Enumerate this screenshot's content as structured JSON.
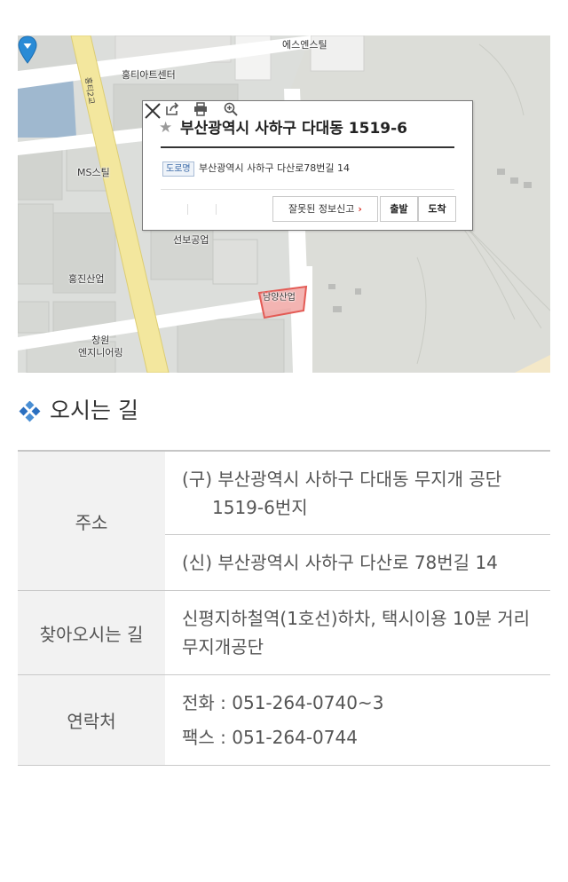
{
  "map": {
    "labels": {
      "es_enstil": "에스엔스틸",
      "hongti_art": "홍티아트센터",
      "bridge": "홍티2교",
      "ms_steel": "MS스틸",
      "seonbo": "선보공업",
      "hongjin": "홍진산업",
      "changwon": "창원\n엔지니어링",
      "namyang": "남양산업"
    },
    "popup": {
      "star_icon": "star-icon",
      "title": "부산광역시 사하구 다대동 1519-6",
      "road_badge": "도로명",
      "road_address": "부산광역시 사하구 다산로78번길 14",
      "report_label": "잘못된 정보신고",
      "report_arrow": "›",
      "depart_label": "출발",
      "arrive_label": "도착"
    }
  },
  "section": {
    "title": "오시는 길"
  },
  "info": {
    "address_header": "주소",
    "address_old_line1": "(구) 부산광역시 사하구 다대동 무지개 공단",
    "address_old_line2": "1519-6번지",
    "address_new": "(신) 부산광역시 사하구 다산로 78번길 14",
    "directions_header": "찾아오시는 길",
    "directions_line1": "신평지하철역(1호선)하차, 택시이용 10분 거리",
    "directions_line2": "무지개공단",
    "contact_header": "연락처",
    "phone": "전화 : 051-264-0740~3",
    "fax": "팩스 : 051-264-0744"
  },
  "colors": {
    "accent_blue": "#2a8bd6",
    "report_arrow": "#d8352a",
    "table_header_bg": "#f2f2f2"
  }
}
